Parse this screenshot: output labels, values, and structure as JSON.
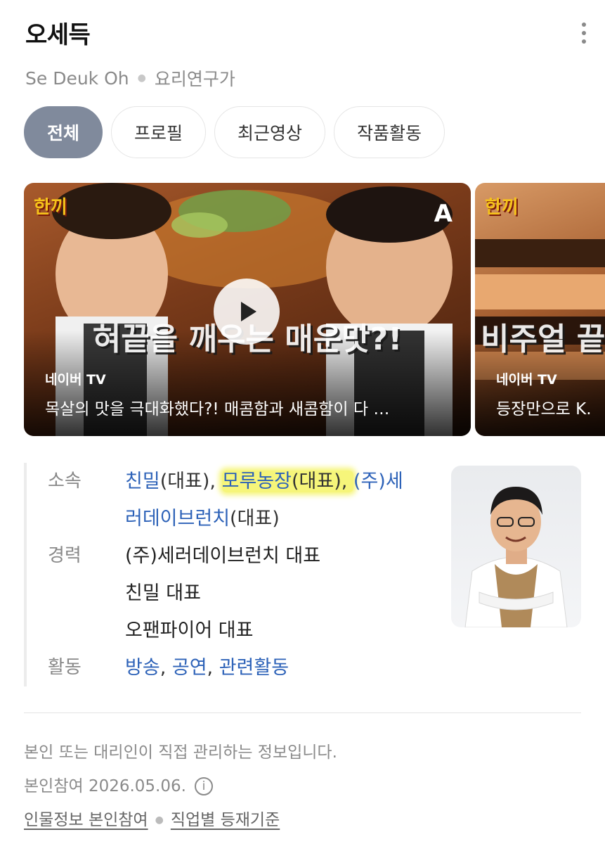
{
  "header": {
    "name": "오세득",
    "english_name": "Se Deuk Oh",
    "occupation": "요리연구가",
    "more_icon": "more-vertical-icon"
  },
  "tabs": [
    {
      "label": "전체",
      "active": true
    },
    {
      "label": "프로필",
      "active": false
    },
    {
      "label": "최근영상",
      "active": false
    },
    {
      "label": "작품활동",
      "active": false
    }
  ],
  "videos": [
    {
      "source": "네이버 TV",
      "title": "목살의 맛을 극대화했다?! 매콤함과 새콤함이 다 …",
      "caption": "혀끝을 깨우는 매운맛?!"
    },
    {
      "source": "네이버 TV",
      "title": "등장만으로 K.",
      "caption": "비주얼 끝"
    }
  ],
  "info": {
    "affiliation_label": "소속",
    "affiliation": [
      {
        "name": "친밀",
        "suffix": "(대표), "
      },
      {
        "name": "모루농장",
        "suffix": "(대표), "
      },
      {
        "name": "(주)세러데이브런치",
        "suffix": "(대표)"
      }
    ],
    "career_label": "경력",
    "career": [
      "(주)세러데이브런치 대표",
      "친밀 대표",
      "오팬파이어 대표"
    ],
    "activity_label": "활동",
    "activities": [
      "방송",
      "공연",
      "관련활동"
    ],
    "activity_sep": ", "
  },
  "footer": {
    "notice": "본인 또는 대리인이 직접 관리하는 정보입니다.",
    "participation": "본인참여 2026.05.06.",
    "links": [
      "인물정보 본인참여",
      "직업별 등재기준"
    ]
  },
  "colors": {
    "link": "#2d62b8",
    "highlight": "#f6f57a",
    "active_tab": "#808a9c"
  }
}
